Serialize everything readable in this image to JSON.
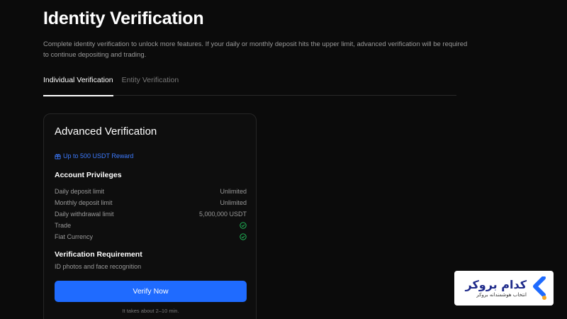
{
  "header": {
    "title": "Identity Verification",
    "description": "Complete identity verification to unlock more features. If your daily or monthly deposit hits the upper limit, advanced verification will be required to continue depositing and trading."
  },
  "tabs": [
    {
      "label": "Individual Verification",
      "active": true
    },
    {
      "label": "Entity Verification",
      "active": false
    }
  ],
  "card": {
    "title": "Advanced Verification",
    "reward": "Up to 500 USDT Reward",
    "privileges_heading": "Account Privileges",
    "privileges": [
      {
        "label": "Daily deposit limit",
        "value": "Unlimited"
      },
      {
        "label": "Monthly deposit limit",
        "value": "Unlimited"
      },
      {
        "label": "Daily withdrawal limit",
        "value": "5,000,000 USDT"
      },
      {
        "label": "Trade",
        "value": "check-icon"
      },
      {
        "label": "Fiat Currency",
        "value": "check-icon"
      }
    ],
    "requirement_heading": "Verification Requirement",
    "requirement_text": "ID photos and face recognition",
    "button_label": "Verify Now",
    "time_note": "It takes about 2–10 min."
  },
  "watermark": {
    "main": "کدام بروکر",
    "sub": "انتخاب هوشمندانه بروکر"
  },
  "colors": {
    "accent": "#1f6bff",
    "reward": "#3d7bff",
    "check": "#22c55e",
    "brand_blue": "#1e6bff",
    "brand_orange": "#f5a623"
  }
}
